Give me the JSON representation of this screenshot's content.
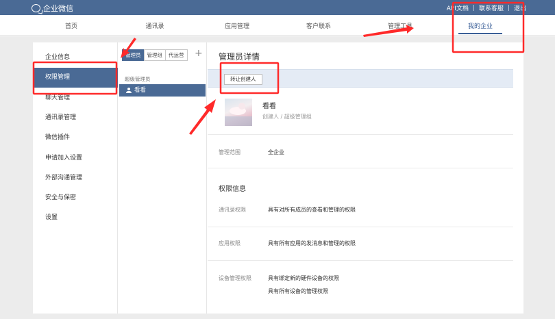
{
  "topbar": {
    "logo_text": "企业微信",
    "links": [
      "API文档",
      "联系客服",
      "退出"
    ]
  },
  "nav": {
    "items": [
      "首页",
      "通讯录",
      "应用管理",
      "客户联系",
      "管理工具",
      "我的企业"
    ],
    "active_index": 5
  },
  "left_menu": {
    "items": [
      "企业信息",
      "权限管理",
      "聊天管理",
      "通讯录管理",
      "微信插件",
      "申请加入设置",
      "外部沟通管理",
      "安全与保密",
      "设置"
    ],
    "active_index": 1
  },
  "mid": {
    "tabs": [
      "管理员",
      "管理组",
      "代运营"
    ],
    "active_tab": 0,
    "add_symbol": "+",
    "group_label": "超级管理员",
    "admin_item": "看看"
  },
  "detail": {
    "title": "管理员详情",
    "transfer_button": "转让创建人",
    "admin_name": "看看",
    "admin_role": "创建人 / 超级管理组",
    "scope_label": "管理范围",
    "scope_value": "全企业",
    "permissions_title": "权限信息",
    "permissions": [
      {
        "label": "通讯录权限",
        "values": [
          "具有对所有成员的查看和管理的权限"
        ]
      },
      {
        "label": "应用权限",
        "values": [
          "具有所有应用的发消息和管理的权限"
        ]
      },
      {
        "label": "设备管理权限",
        "values": [
          "具有绑定新的硬件设备的权限",
          "具有所有设备的管理权限"
        ]
      }
    ]
  },
  "colors": {
    "brand": "#4a6a95",
    "annotation": "#ff2a2a"
  }
}
